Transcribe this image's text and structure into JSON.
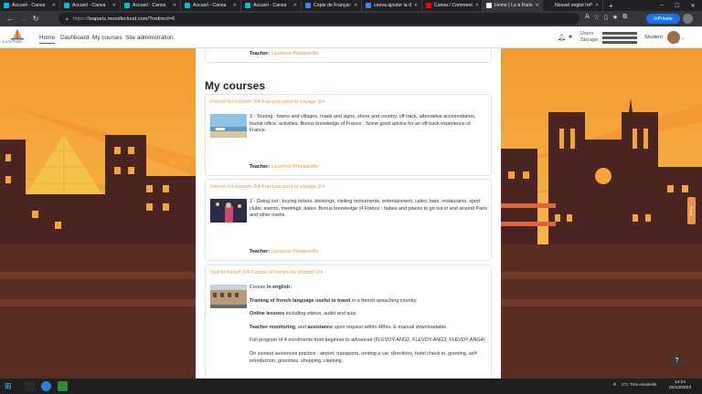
{
  "browser": {
    "tabs": [
      {
        "label": "Accueil - Canva",
        "fav": "#00c4cc",
        "active": false
      },
      {
        "label": "Accueil - Canva",
        "fav": "#00c4cc",
        "active": false
      },
      {
        "label": "Accueil - Canva",
        "fav": "#00c4cc",
        "active": false
      },
      {
        "label": "Accueil - Canva",
        "fav": "#00c4cc",
        "active": false
      },
      {
        "label": "Accueil - Canva",
        "fav": "#00c4cc",
        "active": false
      },
      {
        "label": "Copie de Françai:",
        "fav": "#4285f4",
        "active": false
      },
      {
        "label": "canva ajouter la d",
        "fav": "#4285f4",
        "active": false
      },
      {
        "label": "Canva / Comment",
        "fav": "#ff0000",
        "active": false
      },
      {
        "label": "Home | Lo à Paris",
        "fav": "#ffffff",
        "active": true
      },
      {
        "label": "Nouvel onglet InP",
        "fav": "#202124",
        "active": false
      }
    ],
    "url_prefix": "https://",
    "url": "loaparis.moodlecloud.com/?redirect=0",
    "private_label": "InPrivate"
  },
  "navbar": {
    "logo_text": "Lo à Paris",
    "links": [
      "Home",
      "Dashboard",
      "My courses",
      "Site administration"
    ],
    "users_label": "Users",
    "storage_label": "Storage",
    "role": "Student"
  },
  "top_card": {
    "teacher_label": "Teacher:",
    "teacher_name": "Laurence Pouqueville"
  },
  "section_title": "My courses",
  "courses": [
    {
      "title": "French for tourism 3/4 Français pour le voyage 3/4",
      "desc": "3 - Touring : towns and villages, roads and signs, shore and country, off track, alternative accomodation, tourist office, activities. Bonus knowledge of France : Some good advice for an off-track experience of France.",
      "teacher_label": "Teacher:",
      "teacher_name": "Laurence Pouqueville"
    },
    {
      "title": "French for tourism 2/4 Français pour le voyage 2/4",
      "desc": "2 - Going out : buying tickets, bookings, visiting monuments, entertainment, cafes, bars, restaurants, sport clubs, events, meetings, dates. Bonus knowledge of France : Itabes and places to go out in and around Paris and other towns.",
      "teacher_label": "Teacher:",
      "teacher_name": "Laurence Pouqueville"
    },
    {
      "title": "Visit in french 1/4 Course of french for tourism 1/4",
      "p1_a": "Course ",
      "p1_b": "in english",
      "p1_c": ".",
      "p2_a": "Training of french language useful to travel",
      "p2_b": " in a french speaching country.",
      "p3_a": "Online lessons",
      "p3_b": " including videos, audio and quiz.",
      "p4_a": "Teacher monitoring",
      "p4_b": ", and ",
      "p4_c": "assistance",
      "p4_d": " upon request within 48hrs. E-manual downloadable.",
      "p5": "Full program of 4 enrolments from beginner to advanced (FLEVOY-ANG2, FLEVOY-ANG3, FLEVOY-ANG4).",
      "p6": "On context sentences practice : airport, transports, renting a car, directions, hotel check-in, greeting, self-introduction, groceries, shopping, claiming."
    }
  ],
  "help_label": "?",
  "side_widget_label": "Portal",
  "taskbar": {
    "weather": "3°C  Très ensoleillé",
    "time": "14:24",
    "date": "02/12/2023"
  },
  "colors": {
    "accent_orange": "#f0934a",
    "sky_top": "#f4a236",
    "building_dark": "#3b1f1d",
    "brand_blue": "#1177d1"
  }
}
